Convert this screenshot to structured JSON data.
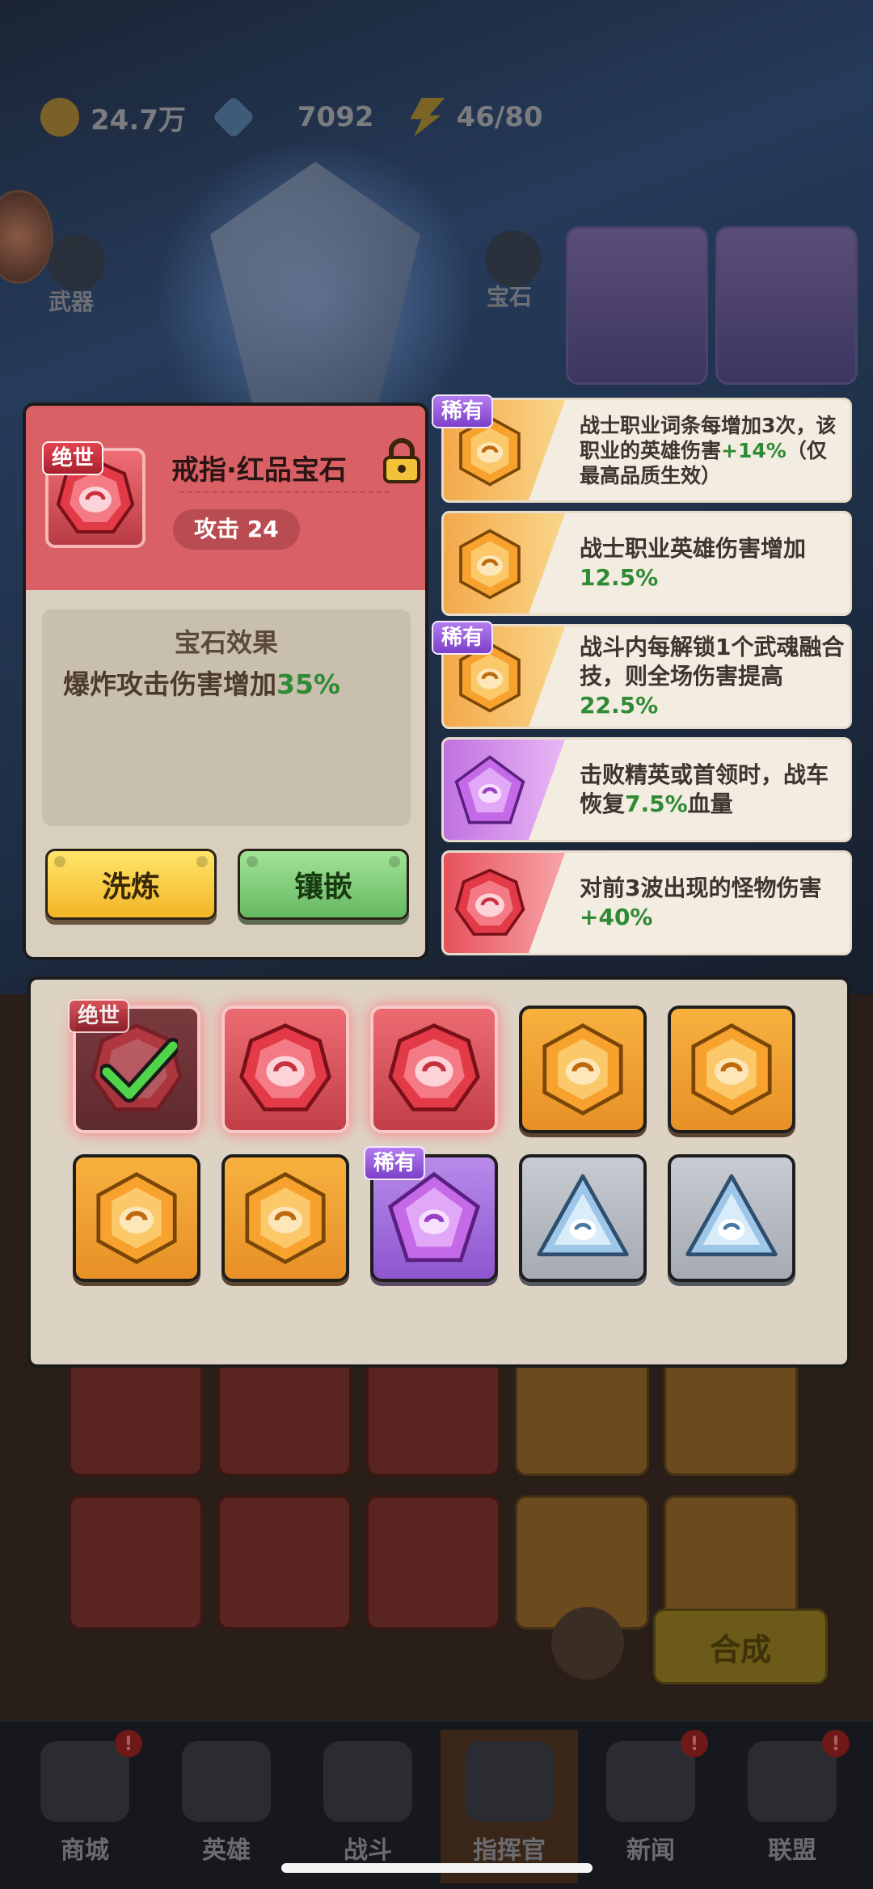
{
  "resources": {
    "gold": "24.7万",
    "diamond": "7092",
    "energy": "46/80"
  },
  "side_labels": {
    "weapon": "武器",
    "gem": "宝石"
  },
  "detail": {
    "rarity": "绝世",
    "title": "戒指·红品宝石",
    "attack": "攻击 24",
    "effect_title": "宝石效果",
    "effect_text": "爆炸攻击伤害增加",
    "effect_value": "35%",
    "wash_label": "洗炼",
    "inlay_label": "镶嵌"
  },
  "effects": [
    {
      "badge": "稀有",
      "color": "orange",
      "parts": [
        "战士职业词条每增加3次，该职业的英雄伤害",
        "+14%",
        "（仅最高品质生效）"
      ]
    },
    {
      "badge": "",
      "color": "orange",
      "parts": [
        "战士职业英雄伤害增加",
        "12.5%",
        ""
      ]
    },
    {
      "badge": "稀有",
      "color": "orange",
      "parts": [
        "战斗内每解锁1个武魂融合技，则全场伤害提高",
        "22.5%",
        ""
      ]
    },
    {
      "badge": "",
      "color": "purple",
      "parts": [
        "击败精英或首领时，战车恢复",
        "7.5%",
        "血量"
      ]
    },
    {
      "badge": "",
      "color": "red",
      "parts": [
        "对前3波出现的怪物伤害",
        "+40%",
        ""
      ]
    }
  ],
  "inventory": {
    "row1": [
      {
        "type": "red",
        "selected": true,
        "badge": "绝世"
      },
      {
        "type": "red"
      },
      {
        "type": "red"
      },
      {
        "type": "orange"
      },
      {
        "type": "orange"
      }
    ],
    "row2": [
      {
        "type": "orange"
      },
      {
        "type": "orange"
      },
      {
        "type": "purple",
        "badge": "稀有"
      },
      {
        "type": "gray"
      },
      {
        "type": "gray"
      }
    ]
  },
  "synth_label": "合成",
  "nav": [
    {
      "label": "商城",
      "badge": "!"
    },
    {
      "label": "英雄",
      "badge": ""
    },
    {
      "label": "战斗",
      "badge": ""
    },
    {
      "label": "指挥官",
      "badge": "",
      "active": true
    },
    {
      "label": "新闻",
      "badge": "!"
    },
    {
      "label": "联盟",
      "badge": "!"
    }
  ],
  "colors": {
    "legend_red": "#d96166",
    "gold_btn": "#f2b526",
    "green_btn": "#65b862",
    "green_text": "#2f8a34"
  }
}
